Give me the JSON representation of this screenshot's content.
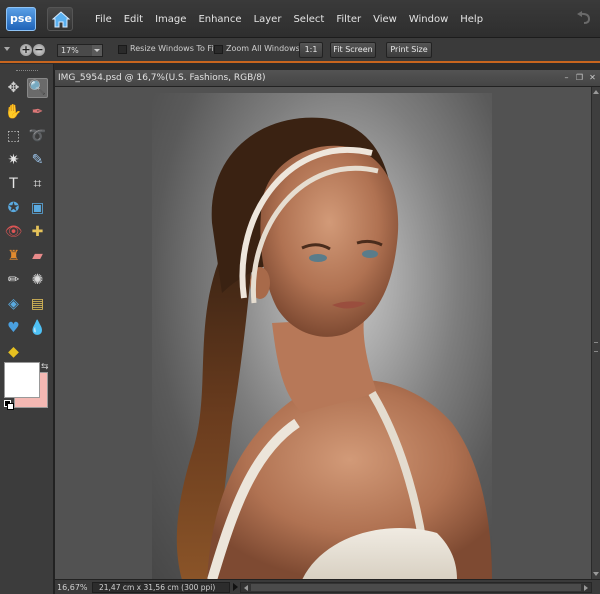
{
  "app": {
    "logo_text": "pse",
    "menu": [
      "File",
      "Edit",
      "Image",
      "Enhance",
      "Layer",
      "Select",
      "Filter",
      "View",
      "Window",
      "Help"
    ]
  },
  "options_bar": {
    "zoom_value": "17%",
    "resize_windows_label": "Resize Windows To Fit",
    "resize_windows_checked": false,
    "zoom_all_label": "Zoom All Windows",
    "zoom_all_checked": false,
    "actual_pixels_label": "1:1",
    "fit_screen_label": "Fit Screen",
    "print_size_label": "Print Size"
  },
  "toolbox": {
    "tools": [
      {
        "row": 0,
        "col": 0,
        "icon": "move-icon",
        "glyph": "✥",
        "color": "#cfcfcf",
        "active": false
      },
      {
        "row": 0,
        "col": 1,
        "icon": "zoom-icon",
        "glyph": "🔍",
        "color": "#dcdcdc",
        "active": true
      },
      {
        "row": 1,
        "col": 0,
        "icon": "hand-icon",
        "glyph": "✋",
        "color": "#e6e6e6",
        "active": false
      },
      {
        "row": 1,
        "col": 1,
        "icon": "eyedropper-icon",
        "glyph": "✒",
        "color": "#d77",
        "active": false
      },
      {
        "row": 2,
        "col": 0,
        "icon": "marquee-icon",
        "glyph": "⬚",
        "color": "#cfcfcf",
        "active": false
      },
      {
        "row": 2,
        "col": 1,
        "icon": "lasso-icon",
        "glyph": "➰",
        "color": "#e3a24a",
        "active": false
      },
      {
        "row": 3,
        "col": 0,
        "icon": "magic-wand-icon",
        "glyph": "✷",
        "color": "#e6e6e6",
        "active": false
      },
      {
        "row": 3,
        "col": 1,
        "icon": "quick-selection-icon",
        "glyph": "✎",
        "color": "#9cc4ea",
        "active": false
      },
      {
        "row": 4,
        "col": 0,
        "icon": "type-icon",
        "glyph": "T",
        "color": "#e6e6e6",
        "active": false
      },
      {
        "row": 4,
        "col": 1,
        "icon": "crop-icon",
        "glyph": "⌗",
        "color": "#e6e6e6",
        "active": false
      },
      {
        "row": 5,
        "col": 0,
        "icon": "cookie-cutter-icon",
        "glyph": "✪",
        "color": "#5aaae0",
        "active": false
      },
      {
        "row": 5,
        "col": 1,
        "icon": "recompose-icon",
        "glyph": "▣",
        "color": "#5aaae0",
        "active": false
      },
      {
        "row": 6,
        "col": 0,
        "icon": "red-eye-icon",
        "glyph": "👁",
        "color": "#d55",
        "active": false
      },
      {
        "row": 6,
        "col": 1,
        "icon": "spot-healing-icon",
        "glyph": "✚",
        "color": "#e6c35a",
        "active": false
      },
      {
        "row": 7,
        "col": 0,
        "icon": "clone-stamp-icon",
        "glyph": "♜",
        "color": "#e08a2e",
        "active": false
      },
      {
        "row": 7,
        "col": 1,
        "icon": "eraser-icon",
        "glyph": "▰",
        "color": "#e88a8a",
        "active": false
      },
      {
        "row": 8,
        "col": 0,
        "icon": "brush-icon",
        "glyph": "✏",
        "color": "#dcdcdc",
        "active": false
      },
      {
        "row": 8,
        "col": 1,
        "icon": "smart-brush-icon",
        "glyph": "✺",
        "color": "#dcdcdc",
        "active": false
      },
      {
        "row": 9,
        "col": 0,
        "icon": "paint-bucket-icon",
        "glyph": "◈",
        "color": "#5aaae0",
        "active": false
      },
      {
        "row": 9,
        "col": 1,
        "icon": "gradient-icon",
        "glyph": "▤",
        "color": "#e6c35a",
        "active": false
      },
      {
        "row": 10,
        "col": 0,
        "icon": "custom-shape-icon",
        "glyph": "♥",
        "color": "#4aa0e0",
        "active": false
      },
      {
        "row": 10,
        "col": 1,
        "icon": "blur-icon",
        "glyph": "💧",
        "color": "#4aa0e0",
        "active": false
      },
      {
        "row": 11,
        "col": 0,
        "icon": "sponge-icon",
        "glyph": "◆",
        "color": "#e6c020",
        "active": false
      }
    ],
    "foreground_color": "#ffffff",
    "background_color": "#f4b8b3"
  },
  "document": {
    "title": "IMG_5954.psd @ 16,7%(U.S. Fashions, RGB/8)",
    "status_zoom": "16,67%",
    "status_info": "21,47 cm x 31,56 cm (300 ppi)"
  }
}
